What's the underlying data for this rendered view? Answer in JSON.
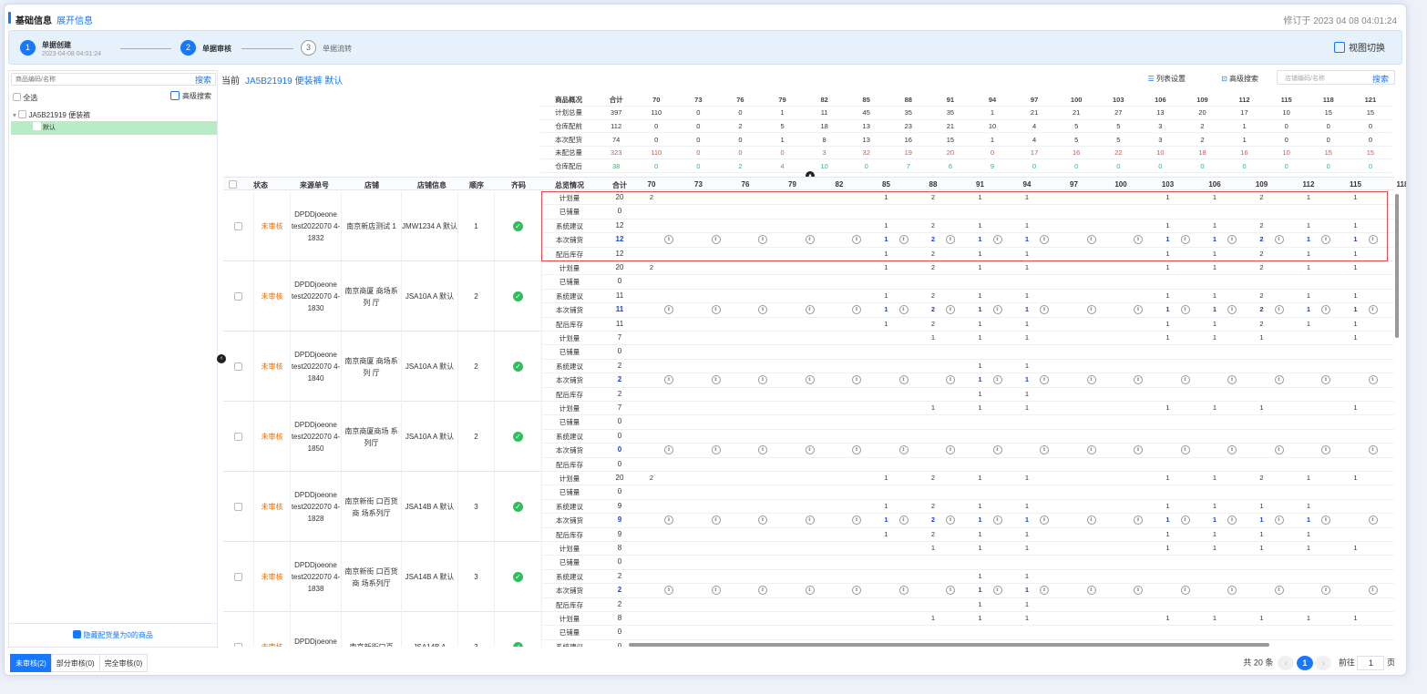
{
  "header": {
    "title": "基础信息",
    "expand": "展开信息",
    "modified": "修订于 2023 04 08 04:01:24"
  },
  "steps": [
    {
      "num": "1",
      "label": "单据创建",
      "date": "2023-04-08 04:01:24"
    },
    {
      "num": "2",
      "label": "单据审核"
    },
    {
      "num": "3",
      "label": "单据流转"
    }
  ],
  "view_switch": "视图切换",
  "left": {
    "search_placeholder": "商品编码/名称",
    "search_btn": "搜索",
    "select_all": "全选",
    "adv_search": "高级搜索",
    "tree_item": "JA5B21919 便装裤",
    "tree_child": "默认",
    "hide_zero": "隐藏配货量为0的商品"
  },
  "current": {
    "label": "当前",
    "value": "JA5B21919 便装裤 默认",
    "list_settings": "列表设置",
    "adv_search": "高级搜索",
    "store_placeholder": "店铺编码/名称",
    "search_btn": "搜索"
  },
  "summary": {
    "headers": [
      "商品概况",
      "合计",
      "70",
      "73",
      "76",
      "79",
      "82",
      "85",
      "88",
      "91",
      "94",
      "97",
      "100",
      "103",
      "106",
      "109",
      "112",
      "115",
      "118",
      "121"
    ],
    "rows": [
      {
        "label": "计划总量",
        "values": [
          "397",
          "110",
          "0",
          "0",
          "1",
          "11",
          "45",
          "35",
          "35",
          "1",
          "21",
          "21",
          "27",
          "13",
          "20",
          "17",
          "10",
          "15",
          "15"
        ],
        "color": "#333"
      },
      {
        "label": "仓库配前",
        "values": [
          "112",
          "0",
          "0",
          "2",
          "5",
          "18",
          "13",
          "23",
          "21",
          "10",
          "4",
          "5",
          "5",
          "3",
          "2",
          "1",
          "0",
          "0",
          "0"
        ],
        "color": "#333"
      },
      {
        "label": "本次配货",
        "values": [
          "74",
          "0",
          "0",
          "0",
          "1",
          "8",
          "13",
          "16",
          "15",
          "1",
          "4",
          "5",
          "5",
          "3",
          "2",
          "1",
          "0",
          "0",
          "0"
        ],
        "color": "#333"
      },
      {
        "label": "未配总量",
        "values": [
          "323",
          "110",
          "0",
          "0",
          "0",
          "3",
          "32",
          "19",
          "20",
          "0",
          "17",
          "16",
          "22",
          "10",
          "18",
          "16",
          "10",
          "15",
          "15"
        ],
        "color": "#e34b4b"
      },
      {
        "label": "仓库配后",
        "values": [
          "38",
          "0",
          "0",
          "2",
          "4",
          "10",
          "0",
          "7",
          "6",
          "9",
          "0",
          "0",
          "0",
          "0",
          "0",
          "0",
          "0",
          "0",
          "0"
        ],
        "color": "#3cb371"
      }
    ]
  },
  "table_headers": [
    "状态",
    "来源单号",
    "店铺",
    "店铺信息",
    "顺序",
    "齐码",
    "总览情况",
    "合计",
    "70",
    "73",
    "76",
    "79",
    "82",
    "85",
    "88",
    "91",
    "94",
    "97",
    "100",
    "103",
    "106",
    "109",
    "112",
    "115",
    "118",
    "121"
  ],
  "sublabels": [
    "计划量",
    "已铺量",
    "系统建议",
    "本次铺货",
    "配后库存"
  ],
  "orders": [
    {
      "status": "未审核",
      "src": "DPDDjoeone test2022070 4-1832",
      "store": "南京新店测试 1",
      "info": "JMW1234 A 默认",
      "seq": "1",
      "totals": [
        "20",
        "0",
        "12",
        "12",
        "12"
      ],
      "plan": {
        "0": "2",
        "5": "1",
        "6": "2",
        "7": "1",
        "8": "1",
        "11": "1",
        "12": "1",
        "13": "2",
        "14": "1",
        "15": "1",
        "16": "2"
      },
      "sugg": {
        "5": "1",
        "6": "2",
        "7": "1",
        "8": "1",
        "11": "1",
        "12": "1",
        "13": "2",
        "14": "1",
        "15": "1",
        "16": "1"
      }
    },
    {
      "status": "未审核",
      "src": "DPDDjoeone test2022070 4-1830",
      "store": "南京商厦 商场系列 厅",
      "info": "JSA10A A 默认",
      "seq": "2",
      "totals": [
        "20",
        "0",
        "11",
        "11",
        "11"
      ],
      "plan": {
        "0": "2",
        "5": "1",
        "6": "2",
        "7": "1",
        "8": "1",
        "11": "1",
        "12": "1",
        "13": "2",
        "14": "1",
        "15": "1",
        "16": "2"
      },
      "sugg": {
        "5": "1",
        "6": "2",
        "7": "1",
        "8": "1",
        "11": "1",
        "12": "1",
        "13": "2",
        "14": "1",
        "15": "1"
      }
    },
    {
      "status": "未审核",
      "src": "DPDDjoeone test2022070 4-1840",
      "store": "南京商厦 商场系列 厅",
      "info": "JSA10A A 默认",
      "seq": "2",
      "totals": [
        "7",
        "0",
        "2",
        "2",
        "2"
      ],
      "plan": {
        "6": "1",
        "7": "1",
        "8": "1",
        "11": "1",
        "12": "1",
        "13": "1",
        "15": "1"
      },
      "sugg": {
        "7": "1",
        "8": "1"
      }
    },
    {
      "status": "未审核",
      "src": "DPDDjoeone test2022070 4-1850",
      "store": "南京商厦商场 系列厅",
      "info": "JSA10A A 默认",
      "seq": "2",
      "totals": [
        "7",
        "0",
        "0",
        "0",
        "0"
      ],
      "plan": {
        "6": "1",
        "7": "1",
        "8": "1",
        "11": "1",
        "12": "1",
        "13": "1",
        "15": "1"
      },
      "sugg": {}
    },
    {
      "status": "未审核",
      "src": "DPDDjoeone test2022070 4-1828",
      "store": "南京新街 口百货商 场系列厅",
      "info": "JSA14B A 默认",
      "seq": "3",
      "totals": [
        "20",
        "0",
        "9",
        "9",
        "9"
      ],
      "plan": {
        "0": "2",
        "5": "1",
        "6": "2",
        "7": "1",
        "8": "1",
        "11": "1",
        "12": "1",
        "13": "2",
        "14": "1",
        "15": "1",
        "16": "2"
      },
      "sugg": {
        "5": "1",
        "6": "2",
        "7": "1",
        "8": "1",
        "11": "1",
        "12": "1",
        "13": "1",
        "14": "1"
      }
    },
    {
      "status": "未审核",
      "src": "DPDDjoeone test2022070 4-1838",
      "store": "南京新街 口百货商 场系列厅",
      "info": "JSA14B A 默认",
      "seq": "3",
      "totals": [
        "8",
        "0",
        "2",
        "2",
        "2"
      ],
      "plan": {
        "6": "1",
        "7": "1",
        "8": "1",
        "11": "1",
        "12": "1",
        "13": "1",
        "14": "1",
        "15": "1"
      },
      "sugg": {
        "7": "1",
        "8": "1"
      }
    },
    {
      "status": "未审核",
      "src": "DPDDjoeone test2022070",
      "store": "南京新街口百",
      "info": "JSA14B A",
      "seq": "3",
      "totals": [
        "8",
        "0",
        "0",
        "0",
        "0"
      ],
      "plan": {
        "6": "1",
        "7": "1",
        "8": "1",
        "11": "1",
        "12": "1",
        "13": "1",
        "14": "1",
        "15": "1"
      },
      "sugg": {}
    }
  ],
  "tabs": [
    "未审核(2)",
    "部分审核(0)",
    "完全审核(0)"
  ],
  "pager": {
    "total": "共 20 条",
    "page": "1",
    "goto": "前往",
    "goto_val": "1",
    "unit": "页"
  }
}
